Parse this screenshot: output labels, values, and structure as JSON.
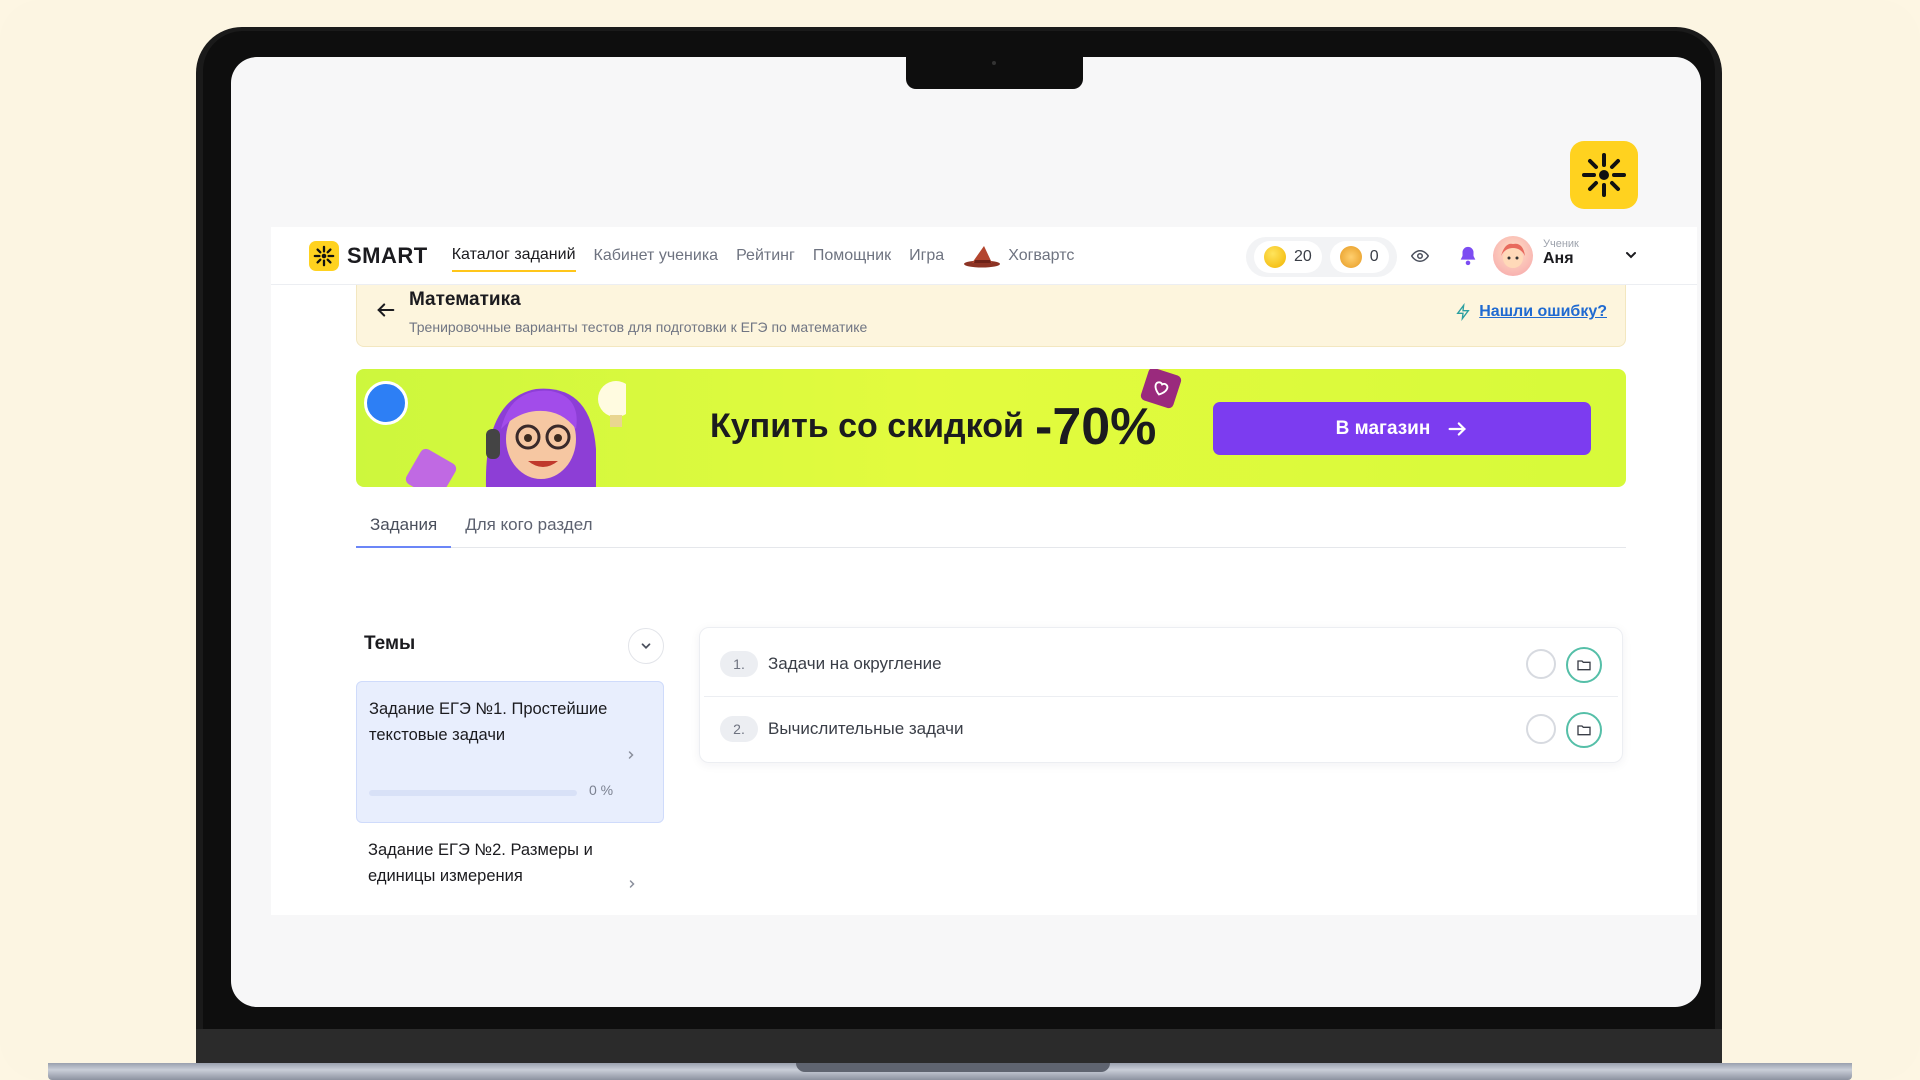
{
  "brand": {
    "name": "SMART",
    "accent": "#ffd21f"
  },
  "nav": {
    "items": [
      {
        "label": "Каталог заданий",
        "active": true
      },
      {
        "label": "Кабинет ученика"
      },
      {
        "label": "Рейтинг"
      },
      {
        "label": "Помощник"
      },
      {
        "label": "Игра"
      }
    ],
    "special": {
      "label": "Хогвартс",
      "icon": "wizard-hat-icon"
    }
  },
  "counters": {
    "coins": "20",
    "bears": "0"
  },
  "user": {
    "role": "Ученик",
    "name": "Аня"
  },
  "subject": {
    "title": "Математика",
    "description": "Тренировочные варианты тестов для подготовки к ЕГЭ по математике",
    "report_label": "Нашли ошибку?"
  },
  "banner": {
    "text": "Купить со скидкой",
    "discount": "-70%",
    "button_label": "В магазин",
    "button_color": "#7c3cf0"
  },
  "tabs": [
    {
      "label": "Задания",
      "active": true
    },
    {
      "label": "Для кого раздел"
    }
  ],
  "topics": {
    "heading": "Темы",
    "items": [
      {
        "title": "Задание ЕГЭ №1. Простейшие текстовые задачи",
        "progress": 0,
        "progress_label": "0 %",
        "active": true
      },
      {
        "title": "Задание ЕГЭ №2. Размеры и единицы измерения"
      }
    ]
  },
  "tasks": [
    {
      "num": "1.",
      "title": "Задачи на округление"
    },
    {
      "num": "2.",
      "title": "Вычислительные задачи"
    }
  ]
}
